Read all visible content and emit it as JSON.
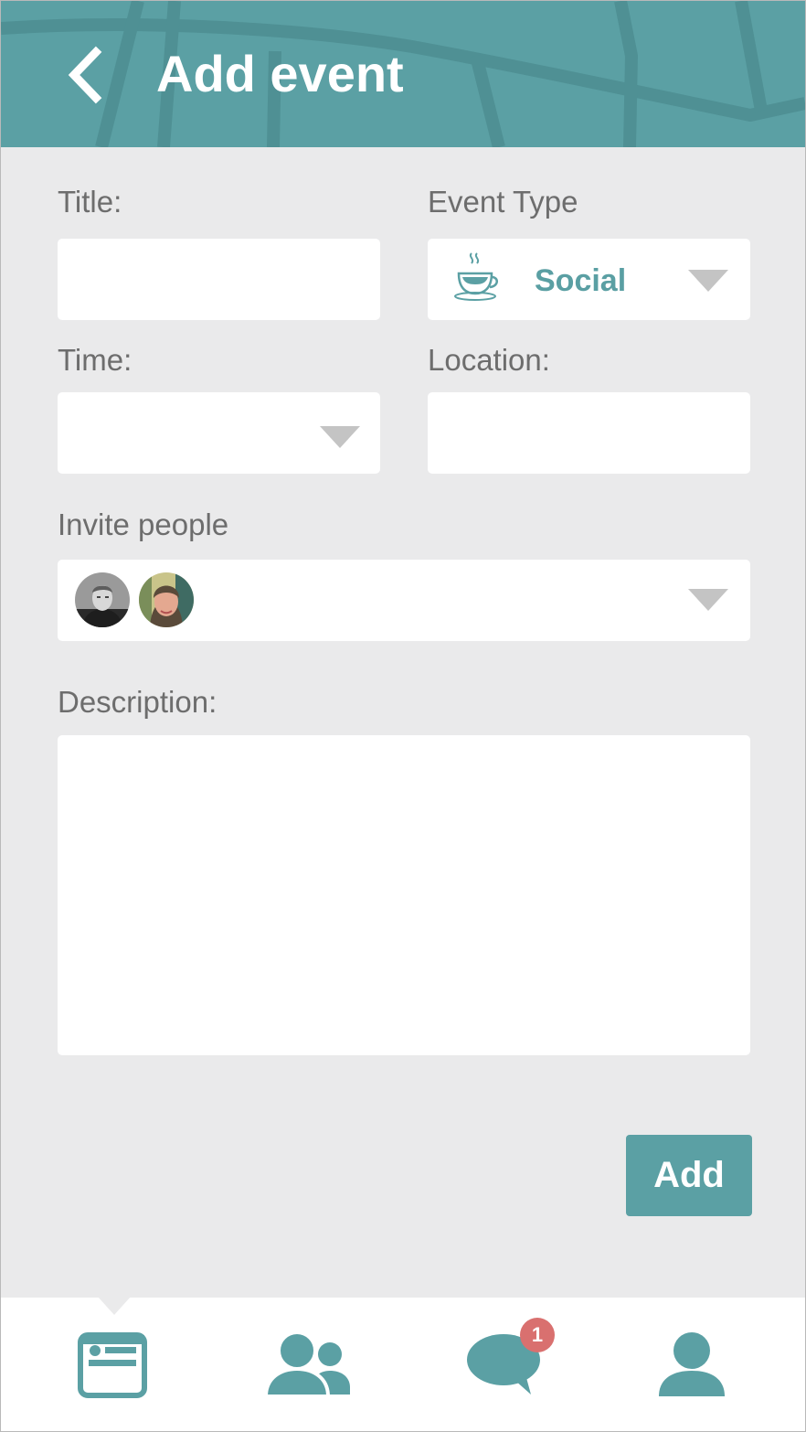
{
  "header": {
    "title": "Add event"
  },
  "form": {
    "title_label": "Title:",
    "title_value": "",
    "event_type_label": "Event Type",
    "event_type_value": "Social",
    "event_type_icon": "coffee-cup-icon",
    "time_label": "Time:",
    "time_value": "",
    "location_label": "Location:",
    "location_value": "",
    "invite_label": "Invite people",
    "invitees": [
      {
        "name": "avatar-person-1"
      },
      {
        "name": "avatar-person-2"
      }
    ],
    "description_label": "Description:",
    "description_value": "",
    "add_label": "Add"
  },
  "bottom_nav": {
    "items": [
      {
        "icon": "events-card-icon",
        "active": true
      },
      {
        "icon": "people-icon"
      },
      {
        "icon": "chat-bubble-icon",
        "badge": "1"
      },
      {
        "icon": "profile-icon"
      }
    ]
  },
  "colors": {
    "accent": "#5ba0a4",
    "background": "#eaeaeb",
    "label": "#6d6d6d",
    "badge": "#d9706f",
    "caret": "#c4c4c4"
  }
}
